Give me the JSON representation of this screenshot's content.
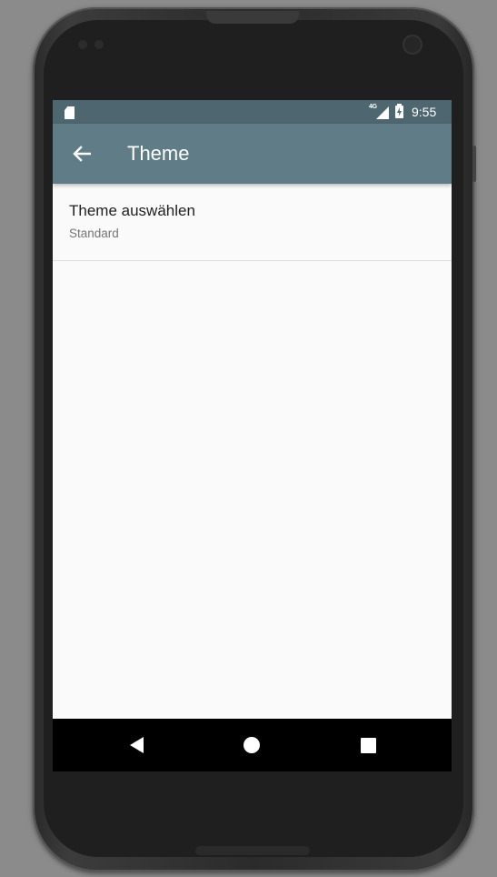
{
  "status_bar": {
    "network_label": "4G",
    "time": "9:55",
    "icons": [
      "sd-card-icon",
      "signal-icon",
      "battery-charging-icon"
    ]
  },
  "app_bar": {
    "title": "Theme",
    "back_icon": "arrow-back-icon",
    "background_color": "#607d87",
    "status_bar_color": "#4e6670"
  },
  "preferences": [
    {
      "title": "Theme auswählen",
      "summary": "Standard"
    }
  ],
  "nav_bar": {
    "buttons": [
      "back-icon",
      "home-icon",
      "recents-icon"
    ]
  }
}
